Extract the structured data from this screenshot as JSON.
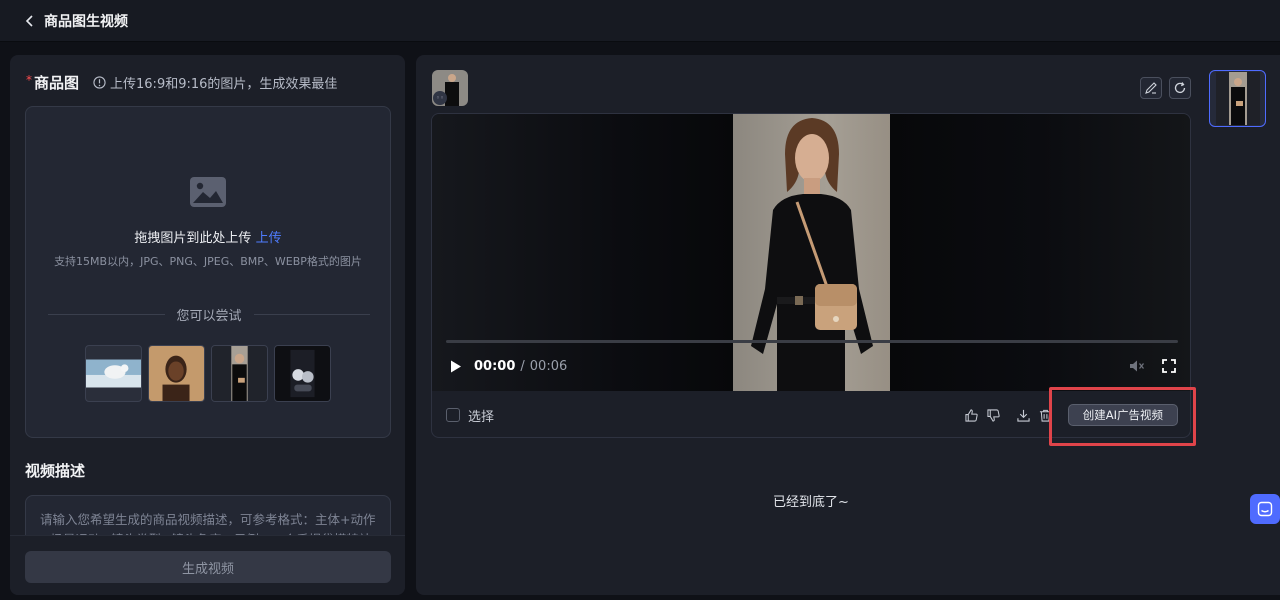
{
  "header": {
    "back_icon": "chevron-left-icon",
    "title": "商品图生视频"
  },
  "left": {
    "product_section": {
      "required_mark": "*",
      "title": "商品图",
      "hint_icon": "info-circle-icon",
      "hint": "上传16:9和9:16的图片，生成效果最佳"
    },
    "upload": {
      "icon": "image-icon",
      "drag_text": "拖拽图片到此处上传",
      "upload_link": "上传",
      "support_text": "支持15MB以内，JPG、PNG、JPEG、BMP、WEBP格式的图片"
    },
    "try": {
      "label": "您可以尝试",
      "samples": [
        "polar-bear-sample",
        "woman-portrait-sample",
        "fashion-bag-sample",
        "earbuds-product-sample"
      ]
    },
    "description": {
      "title": "视频描述",
      "placeholder": "请输入您希望生成的商品视频描述，可参考格式：主体+动作+场景运动+镜头类型+镜头角度，示例：一个手提袋模特站在街头…",
      "value": ""
    },
    "generate_button": "生成视频"
  },
  "right": {
    "toolbar": {
      "edit_icon": "pencil-icon",
      "refresh_icon": "refresh-icon"
    },
    "video": {
      "current_time": "00:00",
      "separator": "/",
      "duration": "00:06",
      "progress": 0,
      "muted": true
    },
    "card_footer": {
      "select_label": "选择",
      "like_icon": "thumbs-up-icon",
      "dislike_icon": "thumbs-down-icon",
      "download_icon": "download-icon",
      "delete_icon": "trash-icon",
      "create_ad_button": "创建AI广告视频"
    },
    "end_text": "已经到底了~"
  },
  "colors": {
    "accent": "#4f6bff",
    "link": "#4f7dff",
    "highlight": "#e0444a",
    "required": "#ff4d4f"
  }
}
